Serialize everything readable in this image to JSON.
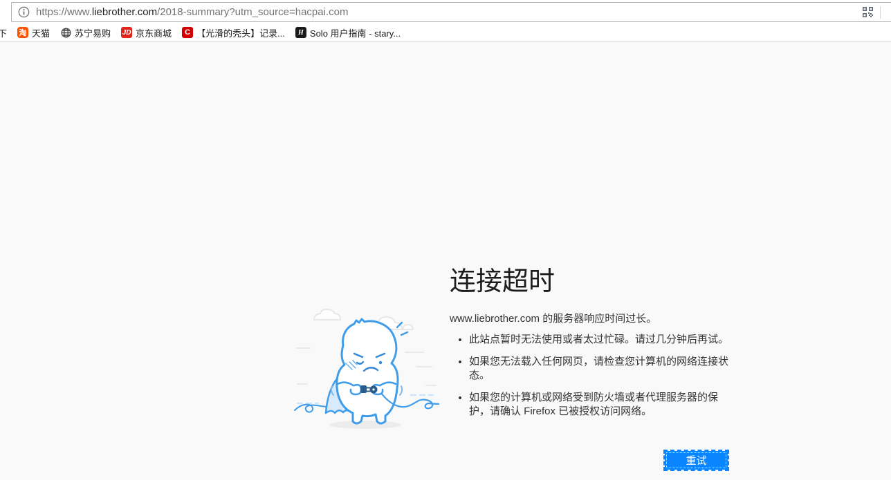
{
  "url_bar": {
    "url_prefix": "https://www.",
    "url_domain": "liebrother.com",
    "url_path": "/2018-summary?utm_source=hacpai.com"
  },
  "bookmarks_bar": {
    "items": [
      {
        "label": "下"
      },
      {
        "label": "天猫",
        "icon": "taobao-icon",
        "icon_text": "淘",
        "icon_color": "#ff5000"
      },
      {
        "label": "苏宁易购",
        "icon": "globe-icon",
        "icon_color": "#4a4a4a"
      },
      {
        "label": "京东商城",
        "icon": "jd-icon",
        "icon_text": "JD",
        "icon_color": "#e1251b"
      },
      {
        "label": "【光滑的秃头】记录...",
        "icon": "csdn-icon",
        "icon_text": "C",
        "icon_color": "#d40000"
      },
      {
        "label": "Solo 用户指南 - stary...",
        "icon": "hacpai-icon",
        "icon_text": "H",
        "icon_color": "#1a1a1a"
      }
    ]
  },
  "error_page": {
    "title": "连接超时",
    "description": "www.liebrother.com 的服务器响应时间过长。",
    "suggestions": [
      "此站点暂时无法使用或者太过忙碌。请过几分钟后再试。",
      "如果您无法载入任何网页，请检查您计算机的网络连接状态。",
      "如果您的计算机或网络受到防火墙或者代理服务器的保护，请确认 Firefox 已被授权访问网络。"
    ],
    "retry_button_label": "重试",
    "colors": {
      "accent_blue": "#0a84ff",
      "illustration_outline_blue": "#3f9ce8",
      "illustration_fill_blue": "#d9eafc",
      "page_background": "#f9f9f9"
    }
  }
}
